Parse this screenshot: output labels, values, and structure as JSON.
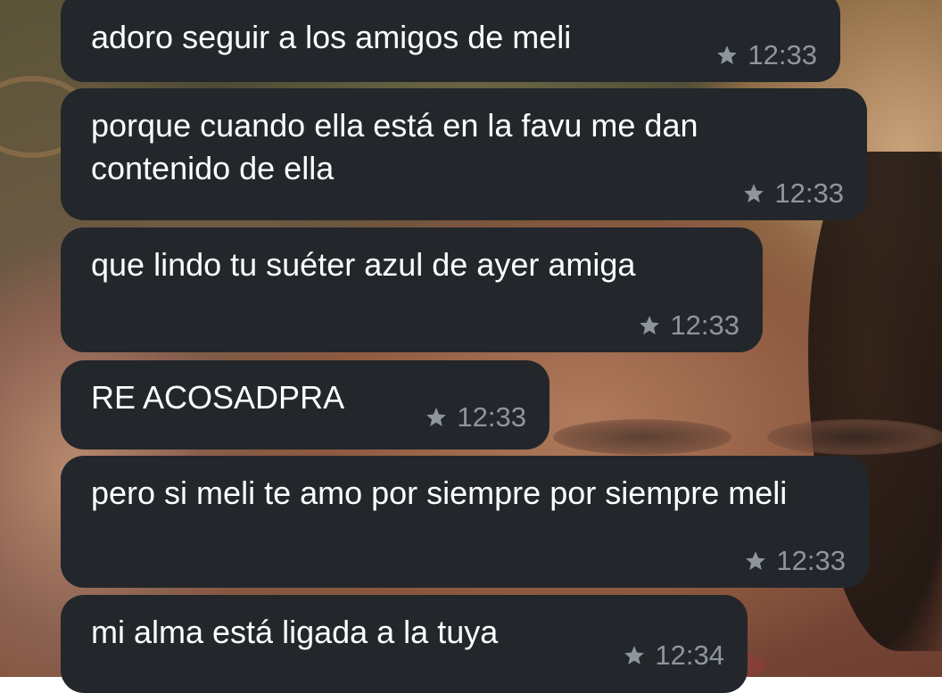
{
  "conversation": {
    "messages": [
      {
        "text": "adoro seguir a los amigos de meli",
        "time": "12:33",
        "starred": true
      },
      {
        "text": "porque cuando ella está en la favu me dan contenido de ella",
        "time": "12:33",
        "starred": true
      },
      {
        "text": "que lindo tu suéter azul de ayer amiga",
        "time": "12:33",
        "starred": true
      },
      {
        "text": "RE ACOSADPRA",
        "time": "12:33",
        "starred": true
      },
      {
        "text": "pero si meli te amo por siempre por siempre meli",
        "time": "12:33",
        "starred": true
      },
      {
        "text": "mi alma está ligada a la tuya",
        "time": "12:34",
        "starred": true
      }
    ]
  },
  "icons": {
    "starred": "star-icon"
  },
  "colors": {
    "bubble_bg": "#23272b",
    "text": "#ffffff",
    "meta": "#8e969c"
  }
}
